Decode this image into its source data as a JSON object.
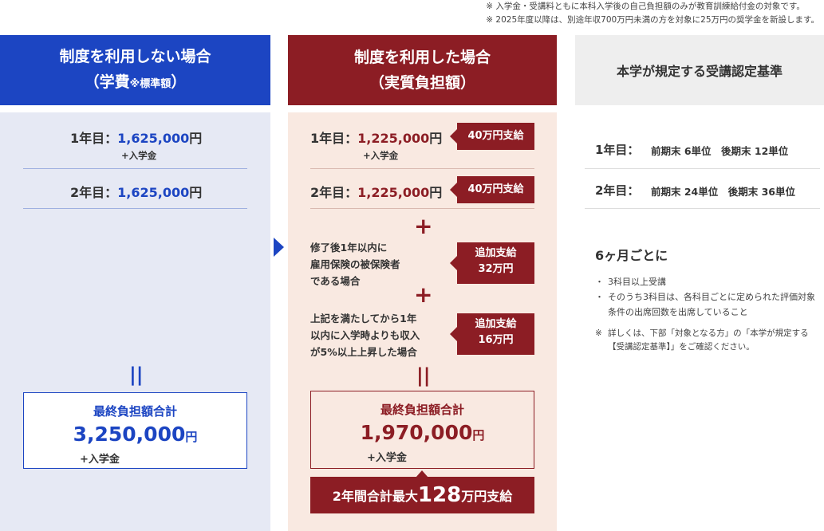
{
  "notes": [
    "※ 入学金・受講料ともに本科入学後の自己負担額のみが教育訓練給付金の対象です。",
    "※ 2025年度以降は、別途年収700万円未満の方を対象に25万円の奨学金を新設します。"
  ],
  "without": {
    "title_line1": "制度を利用しない場合",
    "title_line2_a": "（学費",
    "title_line2_small": "※標準額",
    "title_line2_b": "）",
    "year1_label": "1年目：",
    "year1_amount": "1,625,000",
    "year1_unit": "円",
    "year1_sub": "+入学金",
    "year2_label": "2年目：",
    "year2_amount": "1,625,000",
    "year2_unit": "円",
    "equals": "||",
    "total_title": "最終負担額合計",
    "total_amount": "3,250,000",
    "total_unit": "円",
    "total_extra": "+入学金"
  },
  "with": {
    "title_line1": "制度を利用した場合",
    "title_line2": "（実質負担額）",
    "year1_label": "1年目：",
    "year1_amount": "1,225,000",
    "year1_unit": "円",
    "year1_sub": "+入学金",
    "year1_tag": "40万円支給",
    "year2_label": "2年目：",
    "year2_amount": "1,225,000",
    "year2_unit": "円",
    "year2_tag": "40万円支給",
    "plus": "+",
    "cond1": [
      "修了後1年以内に",
      "雇用保険の被保険者",
      "である場合"
    ],
    "cond1_tag": [
      "追加支給",
      "32万円"
    ],
    "cond2": [
      "上記を満たしてから1年",
      "以内に入学時よりも収入",
      "が5%以上上昇した場合"
    ],
    "cond2_tag": [
      "追加支給",
      "16万円"
    ],
    "equals": "||",
    "total_title": "最終負担額合計",
    "total_amount": "1,970,000",
    "total_unit": "円",
    "total_extra": "+入学金",
    "banner_a": "2年間合計最大",
    "banner_big": "128",
    "banner_b": "万円支給"
  },
  "criteria": {
    "title": "本学が規定する受講認定基準",
    "year1_label": "1年目：",
    "year1_detail": "前期末 6単位　後期末 12単位",
    "year2_label": "2年目：",
    "year2_detail": "前期末 24単位　後期末 36単位",
    "sub_title": "6ヶ月ごとに",
    "bullets": [
      "3科目以上受講",
      "そのうち3科目は、各科目ごとに定められた評価対象条件の出席回数を出席していること"
    ],
    "note_mark": "※",
    "note": "詳しくは、下部「対象となる方」の「本学が規定する【受講認定基準】」をご確認ください。"
  },
  "colors": {
    "blue": "#1c45c2",
    "red": "#8c1d24",
    "blue_bg": "#e6e9f4",
    "red_bg": "#f9e9e1",
    "gray_bg": "#eeeeee"
  }
}
